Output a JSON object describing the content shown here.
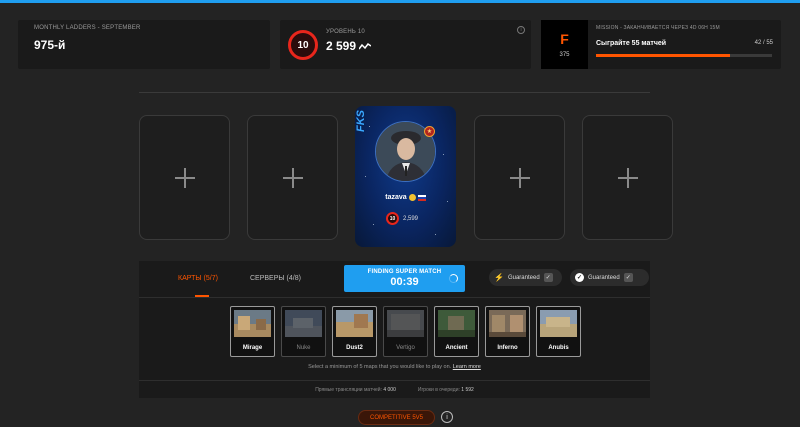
{
  "ladder": {
    "caption": "MONTHLY LADDERS - SEPTEMBER",
    "rank": "975-й"
  },
  "level": {
    "caption": "УРОВЕНЬ 10",
    "badge": "10",
    "elo": "2 599"
  },
  "mission": {
    "logo_letter": "F",
    "logo_number": "375",
    "caption": "MISSION - ЗАКАНЧИВАЕТСЯ ЧЕРЕЗ 4D 06H 15M",
    "title": "Сыграйте 55 матчей",
    "progress": "42 / 55",
    "progress_fraction": 0.76,
    "accent_color": "#ff5500"
  },
  "player": {
    "team_tag": "FKS",
    "name": "tazava",
    "level": "10",
    "elo": "2,599",
    "rank_badge_glyph": "★"
  },
  "queue": {
    "tab_maps": "КАРТЫ (5/7)",
    "tab_servers": "СЕРВЕРЫ (4/8)",
    "find_label": "FINDING SUPER MATCH",
    "timer": "00:39",
    "guarantee_1": "Guaranteed",
    "guarantee_2": "Guaranteed",
    "button_color": "#1f9ef0"
  },
  "maps": [
    {
      "name": "Mirage",
      "selected": true
    },
    {
      "name": "Nuke",
      "selected": false
    },
    {
      "name": "Dust2",
      "selected": true
    },
    {
      "name": "Vertigo",
      "selected": false
    },
    {
      "name": "Ancient",
      "selected": true
    },
    {
      "name": "Inferno",
      "selected": true
    },
    {
      "name": "Anubis",
      "selected": true
    }
  ],
  "hint": {
    "text": "Select a minimum of 5 maps that you would like to play on.",
    "link": "Learn more"
  },
  "stats": {
    "live_label": "Прямые трансляции матчей:",
    "live_value": "4 000",
    "queue_label": "Игроки в очереди:",
    "queue_value": "1 592"
  },
  "mode": {
    "label": "COMPETITIVE 5v5"
  }
}
